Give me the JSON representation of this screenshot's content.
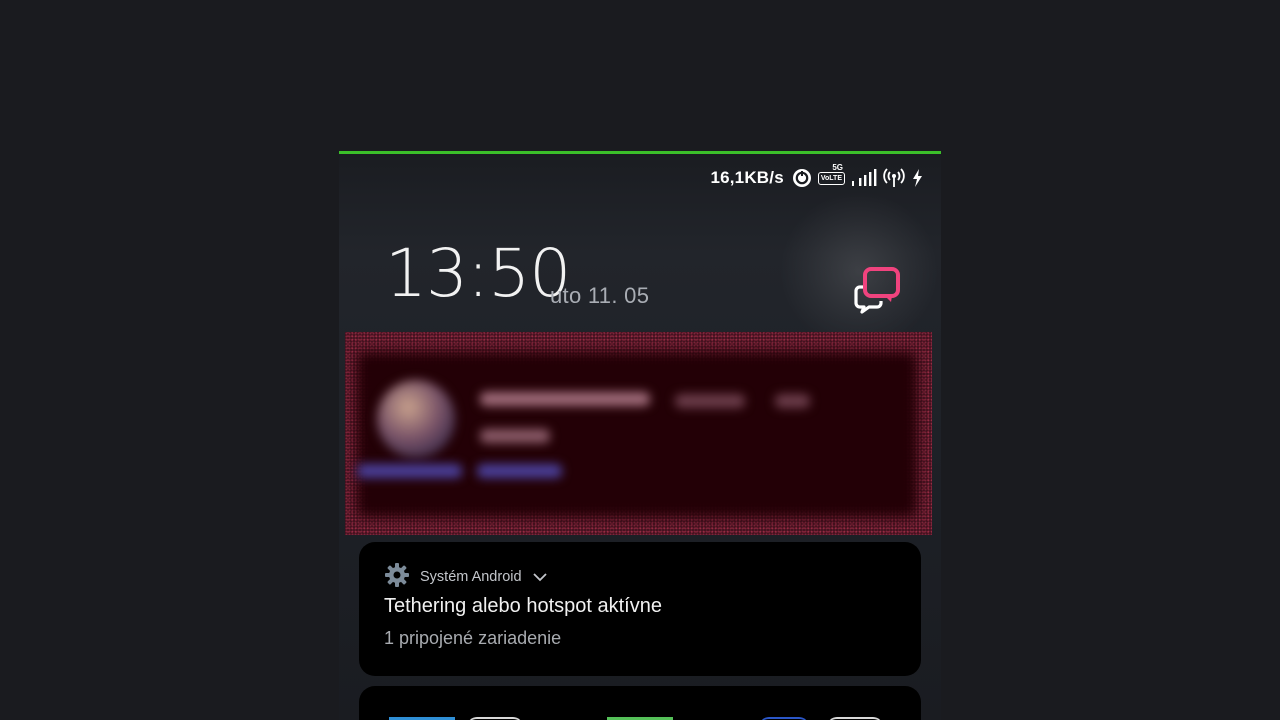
{
  "status_bar": {
    "net_speed": "16,1KB/s",
    "icons": [
      "data-saver-icon",
      "volte-icon",
      "5g-signal-icon",
      "hotspot-icon",
      "charging-icon"
    ],
    "volte_label": "VoLTE",
    "network_type": "5G"
  },
  "lockscreen": {
    "time": "13:50",
    "date": "uto 11. 05"
  },
  "colors": {
    "accent_bar": "#3bbf2a",
    "messaging_icon": "#f0437e"
  },
  "system_notification": {
    "app_name": "Systém Android",
    "title": "Tethering alebo hotspot aktívne",
    "text": "1 pripojené zariadenie",
    "icon": "gear-icon"
  }
}
